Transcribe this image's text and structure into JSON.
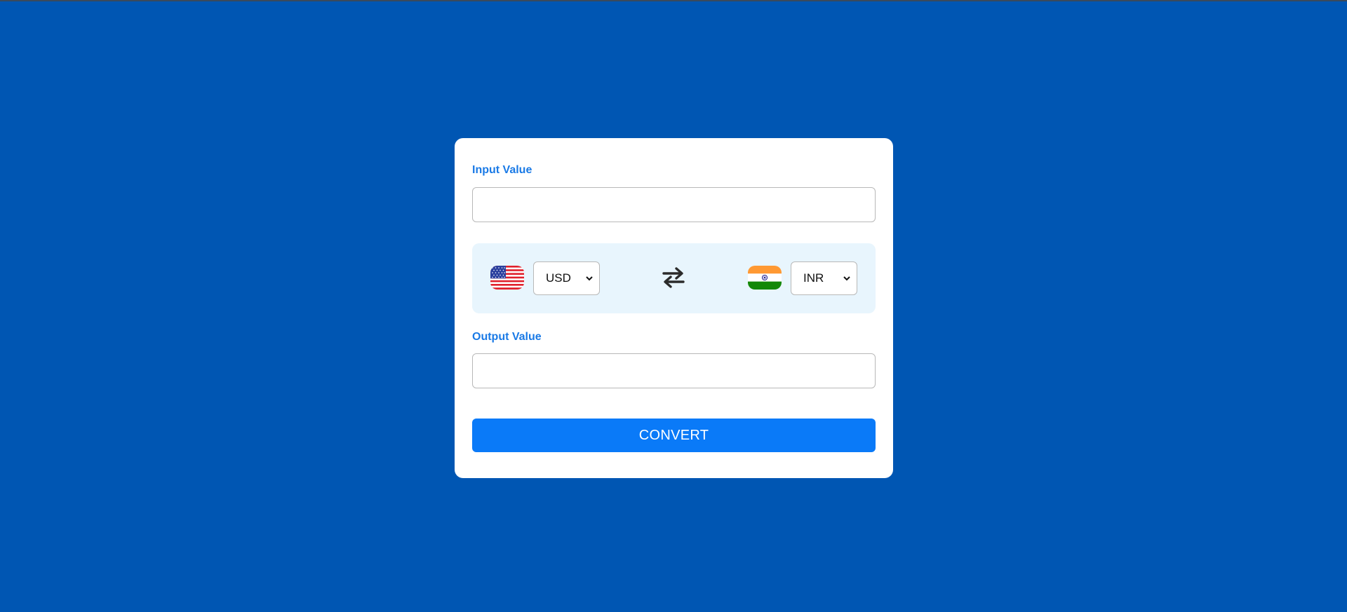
{
  "form": {
    "input_label": "Input Value",
    "input_value": "",
    "output_label": "Output Value",
    "output_value": "",
    "convert_label": "CONVERT"
  },
  "currency": {
    "from": {
      "code": "USD",
      "flag_icon": "us-flag-icon"
    },
    "to": {
      "code": "INR",
      "flag_icon": "india-flag-icon"
    },
    "swap_icon": "swap-arrows-icon"
  },
  "colors": {
    "page_background": "#0056b3",
    "card_background": "#ffffff",
    "accent": "#0a7af8",
    "label": "#1a7ae6",
    "currency_row_background": "#e8f5fd"
  }
}
